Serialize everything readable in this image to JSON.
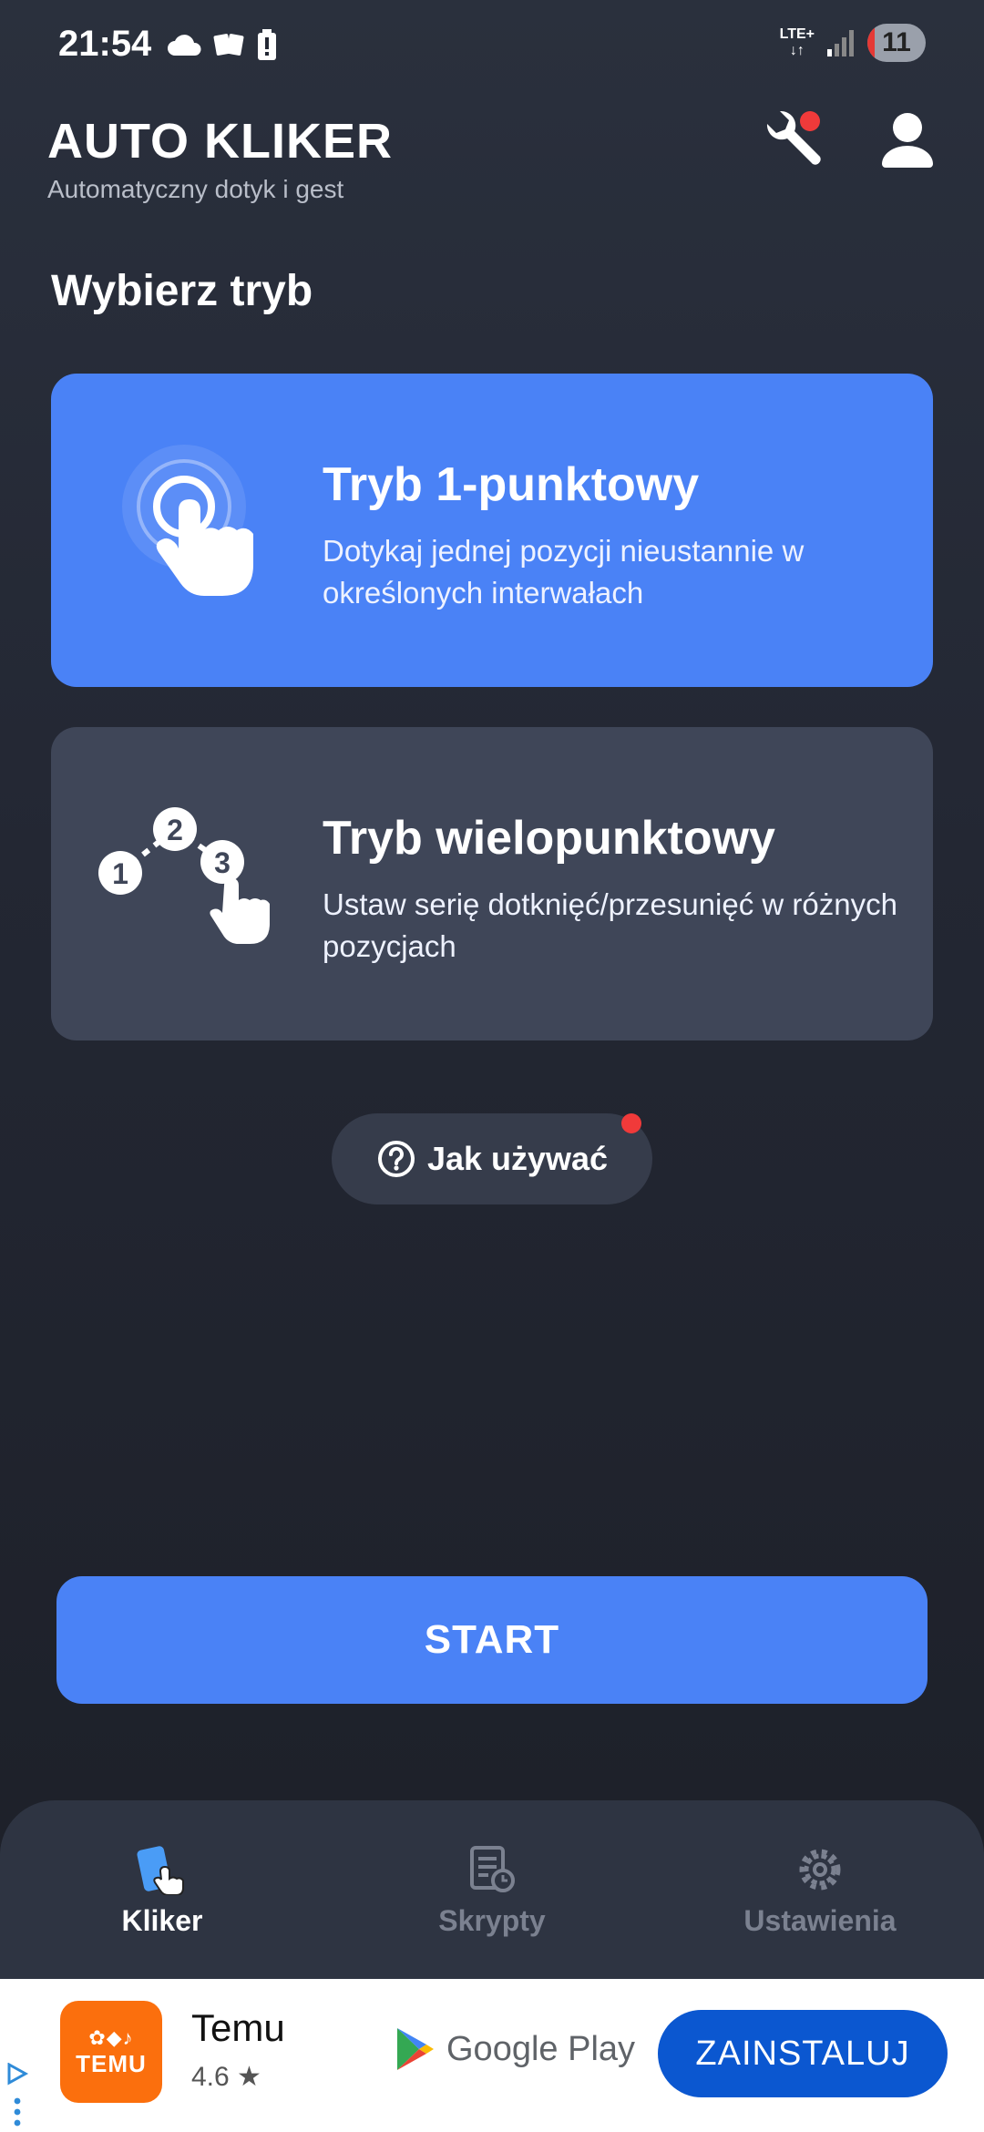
{
  "status_bar": {
    "time": "21:54",
    "network": "LTE+",
    "battery_level": "11"
  },
  "header": {
    "title": "AUTO KLIKER",
    "subtitle": "Automatyczny dotyk i gest",
    "tools_icon": "wrench-icon",
    "profile_icon": "user-icon"
  },
  "main": {
    "section_title": "Wybierz tryb",
    "modes": [
      {
        "title": "Tryb 1-punktowy",
        "description": "Dotykaj jednej pozycji nieustannie w określonych interwałach",
        "color": "#4a82f6"
      },
      {
        "title": "Tryb wielopunktowy",
        "description": "Ustaw serię dotknięć/przesunięć w różnych pozycjach",
        "color": "#3f4658"
      }
    ],
    "how_to_label": "Jak używać",
    "start_label": "START"
  },
  "bottom_nav": {
    "items": [
      {
        "label": "Kliker",
        "icon": "phone-tap-icon",
        "active": true
      },
      {
        "label": "Skrypty",
        "icon": "script-icon",
        "active": false
      },
      {
        "label": "Ustawienia",
        "icon": "gear-icon",
        "active": false
      }
    ]
  },
  "ad": {
    "app_name": "Temu",
    "rating": "4.6 ★",
    "logo_text": "TEMU",
    "store": "Google Play",
    "install_label": "ZAINSTALUJ",
    "accent": "#0b57d0"
  },
  "colors": {
    "primary": "#4a82f6",
    "background": "#232733",
    "badge": "#f03a3a"
  }
}
